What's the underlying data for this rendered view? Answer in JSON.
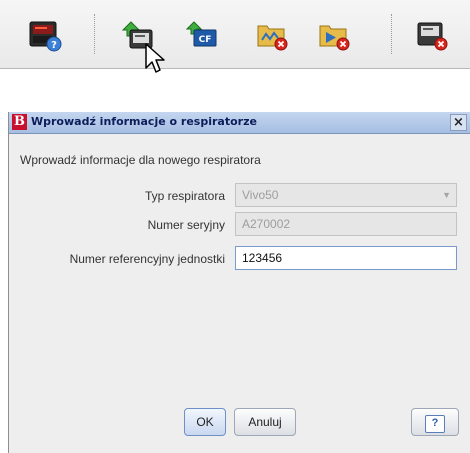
{
  "toolbar": {
    "buttons": [
      {
        "icon": "ventilator-info-icon"
      },
      {
        "icon": "upload-to-device-icon"
      },
      {
        "icon": "upload-to-cf-card-icon",
        "badge": "CF"
      },
      {
        "icon": "delete-trend-folder-icon"
      },
      {
        "icon": "delete-event-folder-icon"
      },
      {
        "icon": "remove-device-icon"
      }
    ]
  },
  "dialog": {
    "app_logo": "B",
    "title": "Wprowadź informacje o respiratorze",
    "close_label": "×",
    "intro": "Wprowadź informacje dla nowego respiratora",
    "fields": {
      "type_label": "Typ respiratora",
      "type_value": "Vivo50",
      "serial_label": "Numer seryjny",
      "serial_value": "A270002",
      "ref_label": "Numer referencyjny jednostki",
      "ref_value": "123456"
    },
    "buttons": {
      "ok": "OK",
      "cancel": "Anuluj",
      "help": "?"
    }
  },
  "colors": {
    "title_bar": "#a5bee3",
    "dialog_bg": "#eeeeee",
    "brand_red": "#c8102e"
  }
}
